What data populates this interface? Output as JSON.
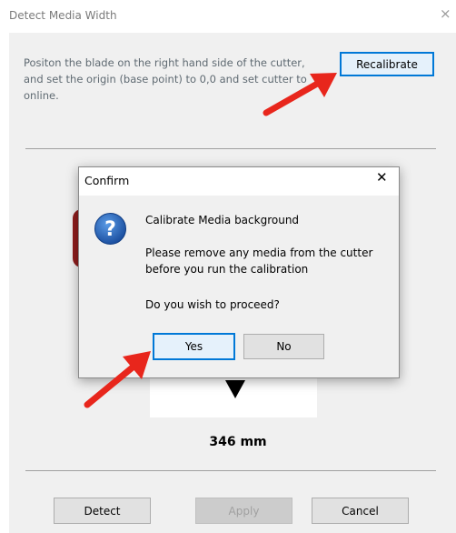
{
  "window": {
    "title": "Detect Media Width",
    "close_glyph": "×",
    "instructions": "Positon the blade on the right hand side of the cutter, and set the origin (base point) to 0,0 and set cutter to online.",
    "recalibrate_label": "Recalibrate",
    "width_value": "346 mm",
    "buttons": {
      "detect": "Detect",
      "apply": "Apply",
      "cancel": "Cancel"
    }
  },
  "confirm_dialog": {
    "title": "Confirm",
    "close_glyph": "✕",
    "heading": "Calibrate Media background",
    "message_line1": "Please remove any media from the cutter",
    "message_line2": "before you run the calibration",
    "question": "Do you wish to proceed?",
    "yes_label": "Yes",
    "no_label": "No"
  },
  "icons": {
    "question": "question-icon",
    "annotation_arrow": "red-arrow"
  },
  "colors": {
    "focus_blue": "#0078d7",
    "icon_blue": "#1e5fb4",
    "annotation_red": "#e8261c"
  }
}
